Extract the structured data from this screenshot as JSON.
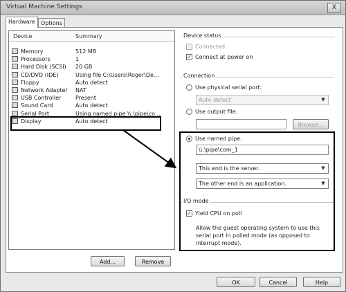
{
  "window": {
    "title": "Virtual Machine Settings",
    "close_glyph": "X"
  },
  "tabs": [
    {
      "label": "Hardware"
    },
    {
      "label": "Options"
    }
  ],
  "device_list": {
    "headers": {
      "device": "Device",
      "summary": "Summary"
    },
    "rows": [
      {
        "device": "Memory",
        "summary": "512 MB",
        "icon": "memory-icon"
      },
      {
        "device": "Processors",
        "summary": "1",
        "icon": "processor-icon"
      },
      {
        "device": "Hard Disk (SCSI)",
        "summary": "20 GB",
        "icon": "hard-disk-icon"
      },
      {
        "device": "CD/DVD (IDE)",
        "summary": "Using file C:\\Users\\Roger\\De...",
        "icon": "cd-dvd-icon"
      },
      {
        "device": "Floppy",
        "summary": "Auto detect",
        "icon": "floppy-icon"
      },
      {
        "device": "Network Adapter",
        "summary": "NAT",
        "icon": "network-adapter-icon"
      },
      {
        "device": "USB Controller",
        "summary": "Present",
        "icon": "usb-icon"
      },
      {
        "device": "Sound Card",
        "summary": "Auto detect",
        "icon": "sound-card-icon"
      },
      {
        "device": "Serial Port",
        "summary": "Using named pipe \\\\.\\pipe\\co ...",
        "icon": "serial-port-icon"
      },
      {
        "device": "Display",
        "summary": "Auto detect",
        "icon": "display-icon"
      }
    ],
    "selected_index": 8
  },
  "list_buttons": {
    "add": "Add...",
    "remove": "Remove"
  },
  "device_status": {
    "title": "Device status",
    "connected": "Connected",
    "connect_at_power_on": "Connect at power on",
    "connect_at_power_on_checked": true
  },
  "connection": {
    "title": "Connection",
    "use_physical": "Use physical serial port:",
    "physical_value": "Auto detect",
    "use_output_file": "Use output file:",
    "output_file_value": "",
    "browse": "Browse...",
    "use_named_pipe": "Use named pipe:",
    "named_pipe_value": "\\\\.\\pipe\\com_1",
    "end_select": "This end is the server.",
    "other_end_select": "The other end is an application."
  },
  "io_mode": {
    "title": "I/O mode",
    "yield_cpu": "Yield CPU on poll",
    "yield_cpu_checked": true,
    "description": "Allow the guest operating system to use this serial port in polled mode (as opposed to interrupt mode)."
  },
  "footer": {
    "ok": "OK",
    "cancel": "Cancel",
    "help": "Help"
  }
}
